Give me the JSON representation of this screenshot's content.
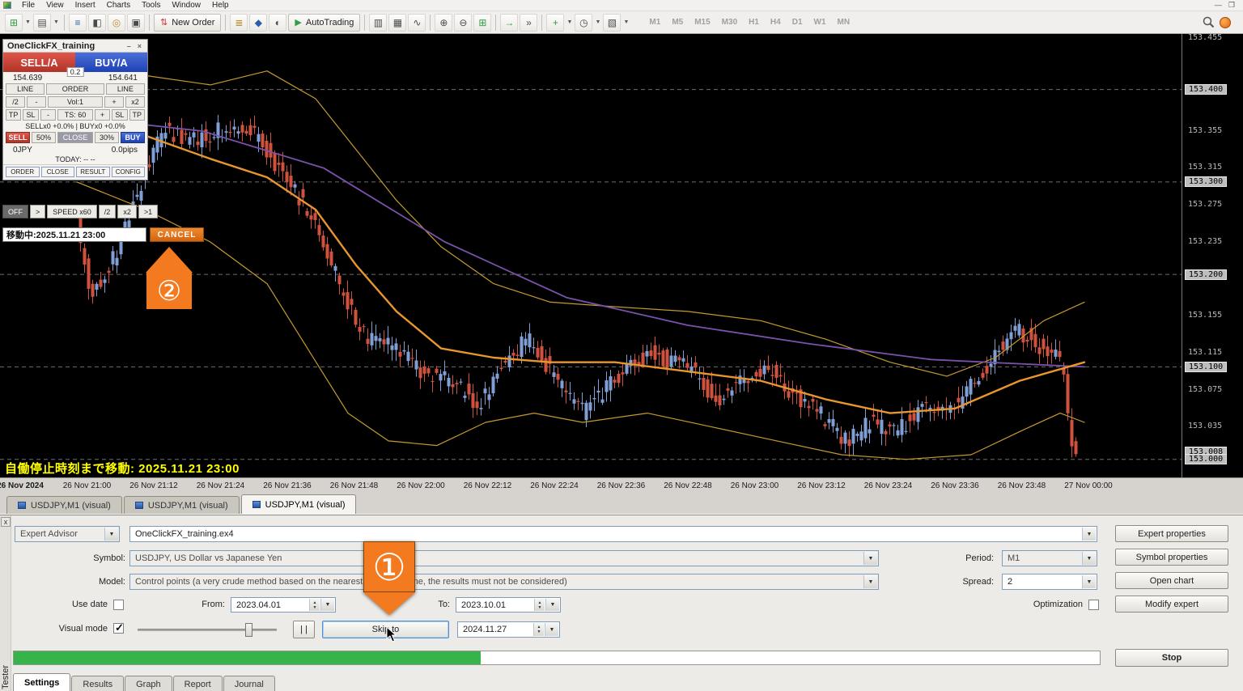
{
  "app": {
    "menu": [
      "File",
      "View",
      "Insert",
      "Charts",
      "Tools",
      "Window",
      "Help"
    ],
    "window_buttons": {
      "minimize": "—",
      "restore": "❐"
    }
  },
  "toolbar": {
    "new_order": "New Order",
    "autotrading": "AutoTrading",
    "timeframes": [
      "M1",
      "M5",
      "M15",
      "M30",
      "H1",
      "H4",
      "D1",
      "W1",
      "MN"
    ]
  },
  "panel": {
    "title": "OneClickFX_training",
    "min_icon": "–",
    "close_icon": "×",
    "sell": "SELL/A",
    "buy": "BUY/A",
    "spread_badge": "0.2",
    "sell_price": "154.639",
    "buy_price": "154.641",
    "line_left": "LINE",
    "order": "ORDER",
    "line_right": "LINE",
    "div2": "/2",
    "minus": "-",
    "vol": "Vol:1",
    "plus": "+",
    "mul2": "x2",
    "tp_l": "TP",
    "sl_l": "SL",
    "minus2": "-",
    "ts": "TS: 60",
    "plus2": "+",
    "sl_r": "SL",
    "tp_r": "TP",
    "multiplier": "SELLx0 +0.0% | BUYx0 +0.0%",
    "close_sell": "SELL",
    "close_50": "50%",
    "close_mid": "CLOSE",
    "close_30": "30%",
    "close_buy": "BUY",
    "pl_jpy": "0JPY",
    "pl_pips": "0.0pips",
    "today": "TODAY: -- --",
    "btn_order": "ORDER",
    "btn_close": "CLOSE",
    "btn_result": "RESULT",
    "btn_config": "CONFIG"
  },
  "speed": {
    "off": "OFF",
    "step": ">",
    "label": "SPEED x60",
    "half": "/2",
    "dbl": "x2",
    "one": ">1"
  },
  "movebar": {
    "text": "移動中:2025.11.21 23:00",
    "cancel": "CANCEL"
  },
  "annotations": {
    "one": "①",
    "two": "②"
  },
  "chart": {
    "status": "自働停止時刻まで移動: 2025.11.21 23:00",
    "time_axis": [
      "26 Nov 2024",
      "26 Nov 21:00",
      "26 Nov 21:12",
      "26 Nov 21:24",
      "26 Nov 21:36",
      "26 Nov 21:48",
      "26 Nov 22:00",
      "26 Nov 22:12",
      "26 Nov 22:24",
      "26 Nov 22:36",
      "26 Nov 22:48",
      "26 Nov 23:00",
      "26 Nov 23:12",
      "26 Nov 23:24",
      "26 Nov 23:36",
      "26 Nov 23:48",
      "27 Nov 00:00"
    ]
  },
  "chart_tabs": {
    "tab1": "USDJPY,M1 (visual)",
    "tab2": "USDJPY,M1 (visual)",
    "tab3": "USDJPY,M1 (visual)"
  },
  "chart_data": {
    "type": "candlestick",
    "symbol": "USDJPY",
    "period": "M1",
    "price_top": 153.46,
    "price_bottom": 153.005,
    "price_axis": [
      {
        "label": "153.455",
        "value": 153.455,
        "boxed": false
      },
      {
        "label": "153.400",
        "value": 153.4,
        "boxed": true
      },
      {
        "label": "153.355",
        "value": 153.355,
        "boxed": false
      },
      {
        "label": "153.315",
        "value": 153.315,
        "boxed": false
      },
      {
        "label": "153.300",
        "value": 153.3,
        "boxed": true
      },
      {
        "label": "153.275",
        "value": 153.275,
        "boxed": false
      },
      {
        "label": "153.235",
        "value": 153.235,
        "boxed": false
      },
      {
        "label": "153.200",
        "value": 153.2,
        "boxed": true
      },
      {
        "label": "153.155",
        "value": 153.155,
        "boxed": false
      },
      {
        "label": "153.115",
        "value": 153.115,
        "boxed": false
      },
      {
        "label": "153.100",
        "value": 153.1,
        "boxed": true
      },
      {
        "label": "153.075",
        "value": 153.075,
        "boxed": false
      },
      {
        "label": "153.035",
        "value": 153.035,
        "boxed": false
      },
      {
        "label": "153.008",
        "value": 153.008,
        "boxed": true
      },
      {
        "label": "153.000",
        "value": 153.0,
        "boxed": true
      }
    ],
    "hlines": [
      153.4,
      153.3,
      153.2,
      153.1,
      153.0
    ],
    "trend": [
      [
        98,
        153.26
      ],
      [
        115,
        153.175
      ],
      [
        150,
        153.23
      ],
      [
        178,
        153.3
      ],
      [
        205,
        153.355
      ],
      [
        240,
        153.345
      ],
      [
        275,
        153.355
      ],
      [
        310,
        153.36
      ],
      [
        335,
        153.33
      ],
      [
        365,
        153.295
      ],
      [
        395,
        153.25
      ],
      [
        425,
        153.185
      ],
      [
        455,
        153.13
      ],
      [
        490,
        153.12
      ],
      [
        525,
        153.095
      ],
      [
        560,
        153.085
      ],
      [
        595,
        153.06
      ],
      [
        625,
        153.1
      ],
      [
        655,
        153.13
      ],
      [
        690,
        153.09
      ],
      [
        725,
        153.05
      ],
      [
        765,
        153.09
      ],
      [
        810,
        153.115
      ],
      [
        855,
        153.1
      ],
      [
        888,
        153.06
      ],
      [
        920,
        153.085
      ],
      [
        950,
        153.1
      ],
      [
        985,
        153.07
      ],
      [
        1015,
        153.05
      ],
      [
        1048,
        153.02
      ],
      [
        1080,
        153.04
      ],
      [
        1112,
        153.03
      ],
      [
        1145,
        153.06
      ],
      [
        1175,
        153.05
      ],
      [
        1205,
        153.08
      ],
      [
        1235,
        153.115
      ],
      [
        1262,
        153.14
      ],
      [
        1292,
        153.12
      ],
      [
        1315,
        153.105
      ],
      [
        1330,
        153.005
      ]
    ],
    "bands": {
      "upper": [
        [
          95,
          153.445
        ],
        [
          180,
          153.415
        ],
        [
          260,
          153.405
        ],
        [
          330,
          153.42
        ],
        [
          390,
          153.39
        ],
        [
          440,
          153.335
        ],
        [
          490,
          153.28
        ],
        [
          545,
          153.23
        ],
        [
          610,
          153.19
        ],
        [
          680,
          153.17
        ],
        [
          760,
          153.165
        ],
        [
          850,
          153.16
        ],
        [
          940,
          153.15
        ],
        [
          1020,
          153.13
        ],
        [
          1100,
          153.105
        ],
        [
          1170,
          153.09
        ],
        [
          1230,
          153.11
        ],
        [
          1290,
          153.15
        ],
        [
          1340,
          153.17
        ]
      ],
      "middle": [
        [
          95,
          153.38
        ],
        [
          180,
          153.35
        ],
        [
          260,
          153.325
        ],
        [
          330,
          153.305
        ],
        [
          390,
          153.27
        ],
        [
          440,
          153.21
        ],
        [
          490,
          153.16
        ],
        [
          545,
          153.12
        ],
        [
          610,
          153.11
        ],
        [
          680,
          153.105
        ],
        [
          760,
          153.105
        ],
        [
          850,
          153.095
        ],
        [
          940,
          153.085
        ],
        [
          1020,
          153.065
        ],
        [
          1100,
          153.05
        ],
        [
          1180,
          153.055
        ],
        [
          1260,
          153.085
        ],
        [
          1340,
          153.105
        ]
      ],
      "lower": [
        [
          95,
          153.3
        ],
        [
          180,
          153.27
        ],
        [
          260,
          153.235
        ],
        [
          330,
          153.19
        ],
        [
          380,
          153.12
        ],
        [
          430,
          153.05
        ],
        [
          480,
          153.02
        ],
        [
          540,
          153.015
        ],
        [
          600,
          153.04
        ],
        [
          660,
          153.05
        ],
        [
          720,
          153.04
        ],
        [
          800,
          153.05
        ],
        [
          880,
          153.035
        ],
        [
          960,
          153.02
        ],
        [
          1040,
          153.005
        ],
        [
          1120,
          153.0
        ],
        [
          1200,
          153.005
        ],
        [
          1260,
          153.03
        ],
        [
          1310,
          153.05
        ],
        [
          1340,
          153.04
        ]
      ],
      "slow_ma": [
        [
          95,
          153.37
        ],
        [
          250,
          153.355
        ],
        [
          400,
          153.315
        ],
        [
          550,
          153.235
        ],
        [
          700,
          153.175
        ],
        [
          850,
          153.145
        ],
        [
          1000,
          153.125
        ],
        [
          1150,
          153.108
        ],
        [
          1340,
          153.1
        ]
      ]
    },
    "colors": {
      "up": "#7f9fd6",
      "down": "#d0523e",
      "band": "#c59a2f",
      "middle_band": "#e8962e",
      "slow_ma": "#7b52ab",
      "background": "#000000"
    }
  },
  "tester": {
    "panel_label": "Tester",
    "close_icon": "x",
    "expert_selector": "Expert Advisor",
    "expert_value": "OneClickFX_training.ex4",
    "symbol_label": "Symbol:",
    "symbol_value": "USDJPY, US Dollar vs Japanese Yen",
    "model_label": "Model:",
    "model_value": "Control points (a very crude method based on the nearest less timeframe, the results must not be considered)",
    "period_label": "Period:",
    "period_value": "M1",
    "spread_label": "Spread:",
    "spread_value": "2",
    "use_date_label": "Use date",
    "from_label": "From:",
    "from_value": "2023.04.01",
    "to_label": "To:",
    "to_value": "2023.10.01",
    "optimization_label": "Optimization",
    "visual_mode_label": "Visual mode",
    "pause_button": "| |",
    "skip_button": "Skip to",
    "skip_date": "2024.11.27",
    "btn_expert_properties": "Expert properties",
    "btn_symbol_properties": "Symbol properties",
    "btn_open_chart": "Open chart",
    "btn_modify_expert": "Modify expert",
    "btn_stop": "Stop",
    "progress_percent": 43,
    "tabs": [
      "Settings",
      "Results",
      "Graph",
      "Report",
      "Journal"
    ]
  }
}
